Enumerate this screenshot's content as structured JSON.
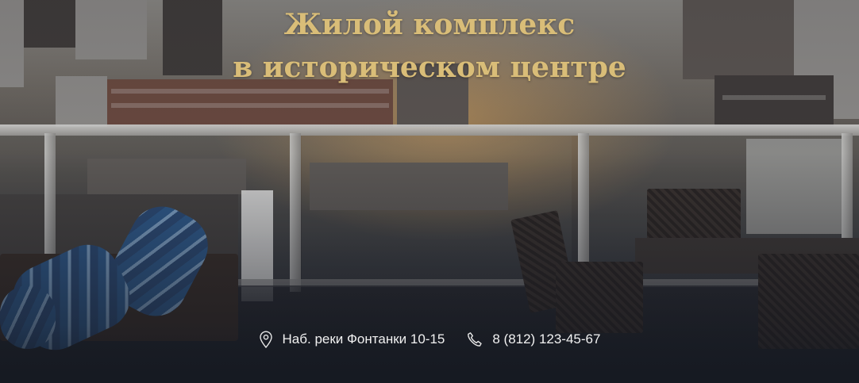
{
  "hero": {
    "title_line1": "Жилой комплекс",
    "title_line2": "в историческом центре",
    "address": {
      "icon": "map-pin-icon",
      "text": "Наб. реки Фонтанки 10-15"
    },
    "phone": {
      "icon": "phone-icon",
      "text": "8 (812) 123-45-67"
    }
  },
  "colors": {
    "title": "#d9bd78",
    "contact_text": "#f1f1f1"
  }
}
